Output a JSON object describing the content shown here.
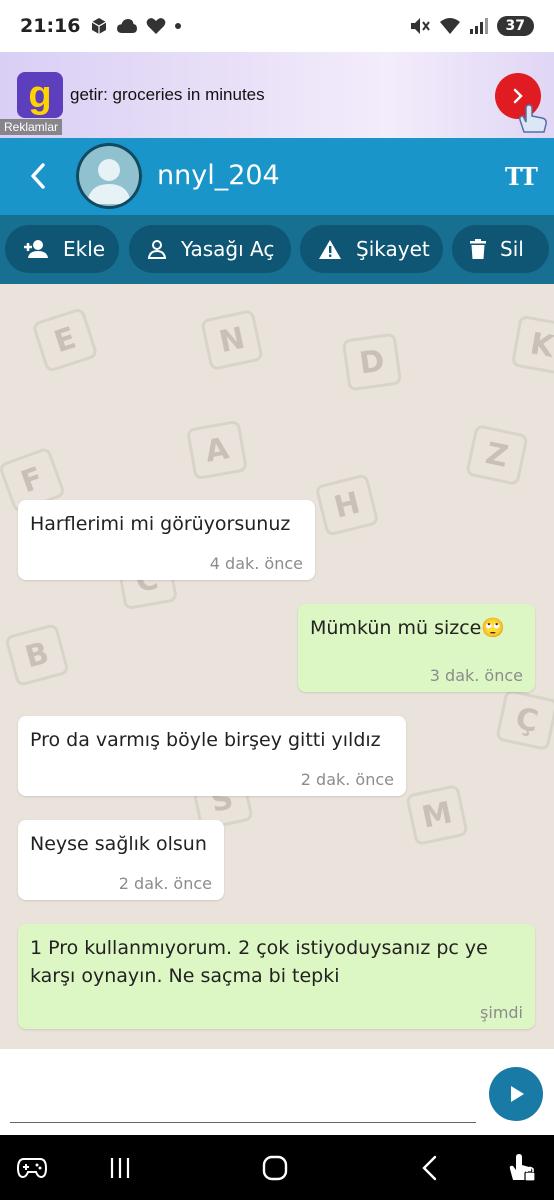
{
  "status_bar": {
    "time": "21:16",
    "battery": "37"
  },
  "ad": {
    "logo_letter": "g",
    "text": "getir: groceries in minutes",
    "label": "Reklamlar"
  },
  "header": {
    "contact_name": "nnyl_204",
    "text_size_glyph": "TT"
  },
  "actions": [
    {
      "label": "Ekle",
      "icon": "add-person-icon"
    },
    {
      "label": "Yasağı Aç",
      "icon": "person-icon"
    },
    {
      "label": "Şikayet",
      "icon": "warning-icon"
    },
    {
      "label": "Sil",
      "icon": "trash-icon"
    }
  ],
  "messages": [
    {
      "direction": "in",
      "lines": [
        "Harflerimi mi görüyorsunuz"
      ],
      "time": "4 dak. önce"
    },
    {
      "direction": "out",
      "lines": [
        "Mümkün mü sizce🙄"
      ],
      "time": "3 dak. önce"
    },
    {
      "direction": "in",
      "lines": [
        "Pro da varmış böyle birşey gitti yıldız"
      ],
      "time": "2 dak. önce"
    },
    {
      "direction": "in",
      "lines": [
        "Neyse sağlık olsun"
      ],
      "time": "2 dak. önce"
    },
    {
      "direction": "out",
      "lines": [
        "1 Pro kullanmıyorum. 2 çok istiyoduysanız pc ye",
        "karşı oynayın. Ne saçma bi tepki"
      ],
      "time": "şimdi"
    }
  ],
  "background_tiles": [
    "E",
    "N",
    "D",
    "K",
    "A",
    "Z",
    "F",
    "H",
    "B",
    "M",
    "C",
    "S",
    "Ç"
  ],
  "colors": {
    "header": "#1a95c9",
    "action_bar": "#176f92",
    "outgoing_bubble": "#ddf7c4",
    "incoming_bubble": "#ffffff",
    "send_button": "#1a7aa6"
  }
}
